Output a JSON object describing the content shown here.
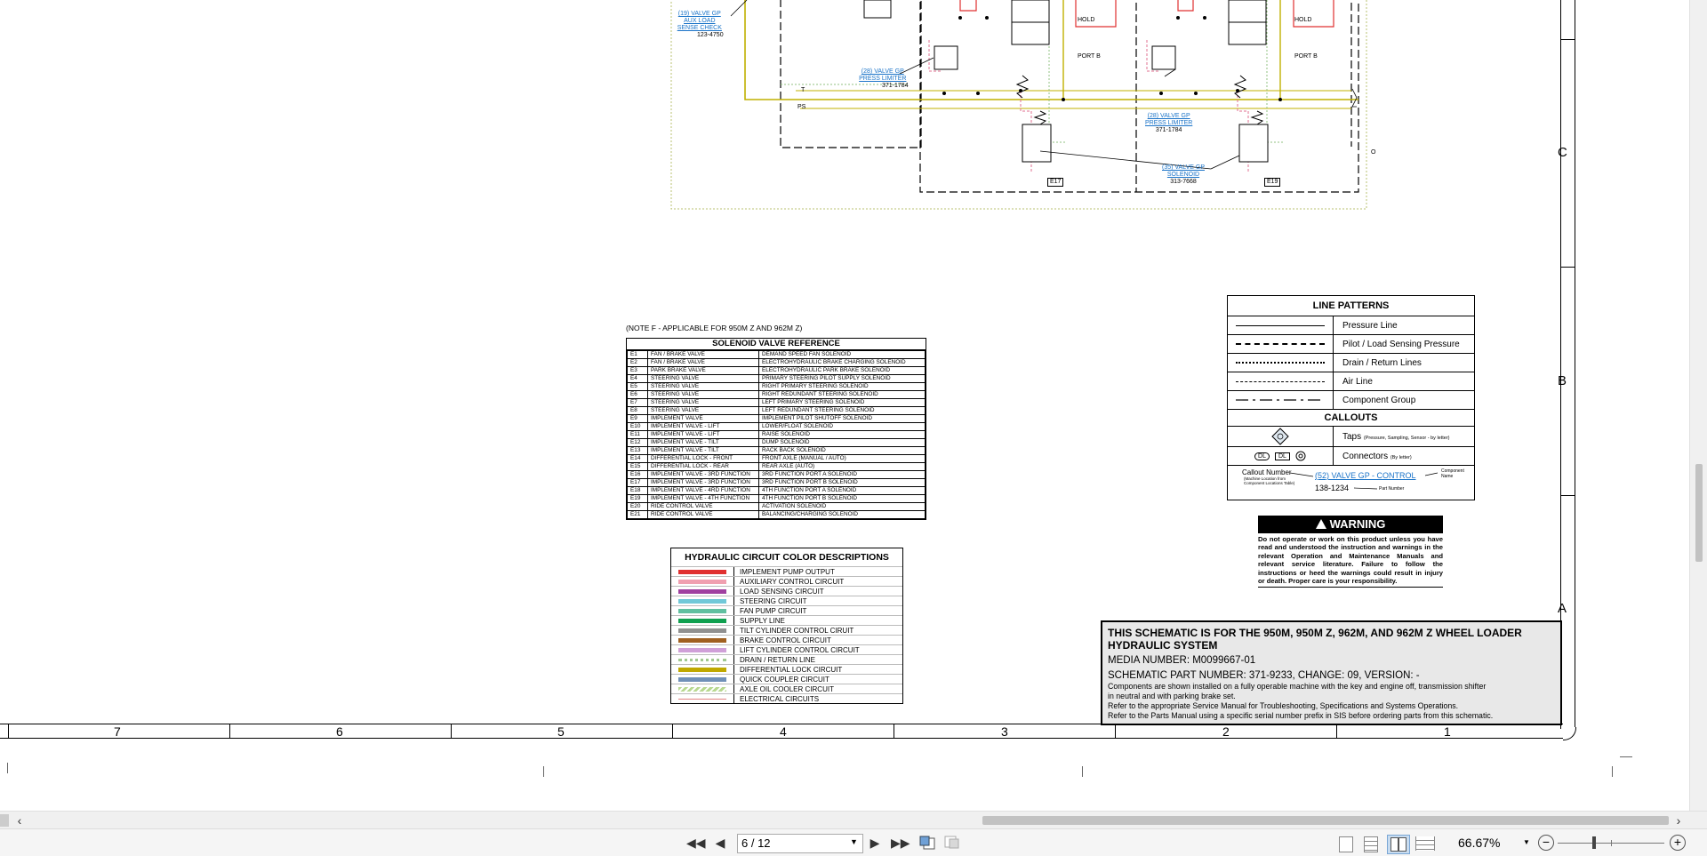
{
  "schematic": {
    "callouts": [
      {
        "label": "(19) VALVE GP",
        "line2": "AUX LOAD",
        "line3": "SENSE CHECK",
        "part": "123-4750"
      },
      {
        "label": "(28) VALVE GP",
        "line2": "PRESS LIMITER",
        "part": "371-1784"
      },
      {
        "label": "(28) VALVE GP",
        "line2": "PRESS LIMITER",
        "part": "371-1784"
      },
      {
        "label": "(35) VALVE GP",
        "line2": "SOLENOID",
        "part": "313-7668"
      }
    ],
    "port_labels": {
      "hold": "HOLD",
      "port_b": "PORT B",
      "t": "T",
      "ps": "PS",
      "o": "O"
    },
    "solenoid_tags": [
      "E17",
      "E19"
    ],
    "grid_columns": [
      "7",
      "6",
      "5",
      "4",
      "3",
      "2",
      "1"
    ],
    "grid_rows": [
      "C",
      "B",
      "A"
    ]
  },
  "solenoid_reference": {
    "note": "(NOTE F - APPLICABLE FOR 950M Z AND 962M Z)",
    "title": "SOLENOID VALVE REFERENCE",
    "rows": [
      [
        "E1",
        "FAN / BRAKE VALVE",
        "DEMAND SPEED FAN SOLENOID"
      ],
      [
        "E2",
        "FAN / BRAKE VALVE",
        "ELECTROHYDRAULIC BRAKE CHARGING SOLENOID"
      ],
      [
        "E3",
        "PARK BRAKE VALVE",
        "ELECTROHYDRAULIC PARK BRAKE SOLENOID"
      ],
      [
        "E4",
        "STEERING VALVE",
        "PRIMARY STEERING PILOT SUPPLY SOLENOID"
      ],
      [
        "E5",
        "STEERING VALVE",
        "RIGHT PRIMARY STEERING SOLENOID"
      ],
      [
        "E6",
        "STEERING VALVE",
        "RIGHT REDUNDANT STEERING SOLENOID"
      ],
      [
        "E7",
        "STEERING VALVE",
        "LEFT PRIMARY STEERING SOLENOID"
      ],
      [
        "E8",
        "STEERING VALVE",
        "LEFT REDUNDANT STEERING SOLENOID"
      ],
      [
        "E9",
        "IMPLEMENT VALVE",
        "IMPLEMENT PILOT SHUTOFF SOLENOID"
      ],
      [
        "E10",
        "IMPLEMENT VALVE - LIFT",
        "LOWER/FLOAT SOLENOID"
      ],
      [
        "E11",
        "IMPLEMENT VALVE - LIFT",
        "RAISE SOLENOID"
      ],
      [
        "E12",
        "IMPLEMENT VALVE - TILT",
        "DUMP SOLENOID"
      ],
      [
        "E13",
        "IMPLEMENT VALVE - TILT",
        "RACK BACK SOLENOID"
      ],
      [
        "E14",
        "DIFFERENTIAL LOCK - FRONT",
        "FRONT AXLE (MANUAL / AUTO)"
      ],
      [
        "E15",
        "DIFFERENTIAL LOCK - REAR",
        "REAR AXLE (AUTO)"
      ],
      [
        "E16",
        "IMPLEMENT VALVE - 3RD FUNCTION",
        "3RD FUNCTION PORT A SOLENOID"
      ],
      [
        "E17",
        "IMPLEMENT VALVE - 3RD FUNCTION",
        "3RD FUNCTION PORT B SOLENOID"
      ],
      [
        "E18",
        "IMPLEMENT VALVE - 4RD FUNCTION",
        "4TH FUNCTION PORT A SOLENOID"
      ],
      [
        "E19",
        "IMPLEMENT VALVE - 4TH FUNCTION",
        "4TH FUNCTION PORT B SOLENOID"
      ],
      [
        "E20",
        "RIDE CONTROL VALVE",
        "ACTIVATION SOLENOID"
      ],
      [
        "E21",
        "RIDE CONTROL VALVE",
        "BALANCING/CHARGING SOLENOID"
      ]
    ]
  },
  "color_descriptions": {
    "title": "HYDRAULIC CIRCUIT COLOR DESCRIPTIONS",
    "rows": [
      {
        "label": "IMPLEMENT PUMP OUTPUT",
        "color": "#e03030"
      },
      {
        "label": "AUXILIARY CONTROL CIRCUIT",
        "color": "#f0a0b0"
      },
      {
        "label": "LOAD SENSING CIRCUIT",
        "color": "#a040a0"
      },
      {
        "label": "STEERING CIRCUIT",
        "color": "#70c8d8"
      },
      {
        "label": "FAN PUMP CIRCUIT",
        "color": "#60c0a0"
      },
      {
        "label": "SUPPLY LINE",
        "color": "#10a050"
      },
      {
        "label": "TILT CYLINDER CONTROL CIRUIT",
        "color": "#909090"
      },
      {
        "label": "BRAKE CONTROL CIRCUIT",
        "color": "#a06020"
      },
      {
        "label": "LIFT CYLINDER CONTROL CIRCUIT",
        "color": "#d0a0d8"
      },
      {
        "label": "DRAIN / RETURN LINE",
        "color": "#a0c890"
      },
      {
        "label": "DIFFERENTIAL LOCK CIRCUIT",
        "color": "#c0a800"
      },
      {
        "label": "QUICK COUPLER CIRCUIT",
        "color": "#7090b8"
      },
      {
        "label": "AXLE OIL COOLER CIRCUIT",
        "color": "#b8d890"
      },
      {
        "label": "ELECTRICAL CIRCUITS",
        "color": "#e08080"
      }
    ]
  },
  "line_patterns": {
    "title": "LINE PATTERNS",
    "rows": [
      "Pressure Line",
      "Pilot / Load Sensing Pressure",
      "Drain / Return Lines",
      "Air Line",
      "Component Group"
    ],
    "callouts_title": "CALLOUTS",
    "taps_label": "Taps",
    "taps_note": "(Pressure, Sampling, Sensor - by letter)",
    "connectors_label": "Connectors",
    "connectors_note": "(By letter)",
    "connector_tags": [
      "DL",
      "DL"
    ],
    "callout_number_label": "Callout Number",
    "callout_number_note": "(Machine Location from Component Locations Table)",
    "callout_example": "(52) VALVE GP - CONTROL",
    "component_name_label": "Component Name",
    "part_number_example": "138-1234",
    "part_number_label": "Part Number"
  },
  "warning": {
    "title": "WARNING",
    "text": "Do not operate or work on this product unless you have read and understood the instruction and warnings in the relevant Operation and Maintenance Manuals and relevant service literature. Failure to follow the instructions or heed the warnings could result in injury or death. Proper care is your responsibility."
  },
  "title_block": {
    "heading": "THIS SCHEMATIC IS FOR THE 950M, 950M Z, 962M, AND 962M Z WHEEL LOADER HYDRAULIC SYSTEM",
    "media_number": "MEDIA NUMBER: M0099667-01",
    "part_number": "SCHEMATIC PART NUMBER: 371-9233, CHANGE: 09, VERSION: -",
    "note1": "Components are shown installed on a fully operable machine with the key and engine off, transmission shifter",
    "note2": "in neutral and with parking brake set.",
    "note3": "Refer to the appropriate Service Manual for Troubleshooting, Specifications and Systems Operations.",
    "note4": "Refer to the Parts Manual using a specific serial number prefix in SIS before ordering parts from this schematic."
  },
  "viewer": {
    "page_value": "6 / 12",
    "zoom": "66.67%",
    "icons": [
      "first-page-icon",
      "prev-page-icon",
      "next-page-icon",
      "last-page-icon",
      "go-back-view-icon",
      "go-forward-view-icon",
      "single-page-icon",
      "continuous-icon",
      "two-page-icon",
      "two-page-continuous-icon",
      "zoom-out-icon",
      "zoom-in-icon"
    ]
  }
}
